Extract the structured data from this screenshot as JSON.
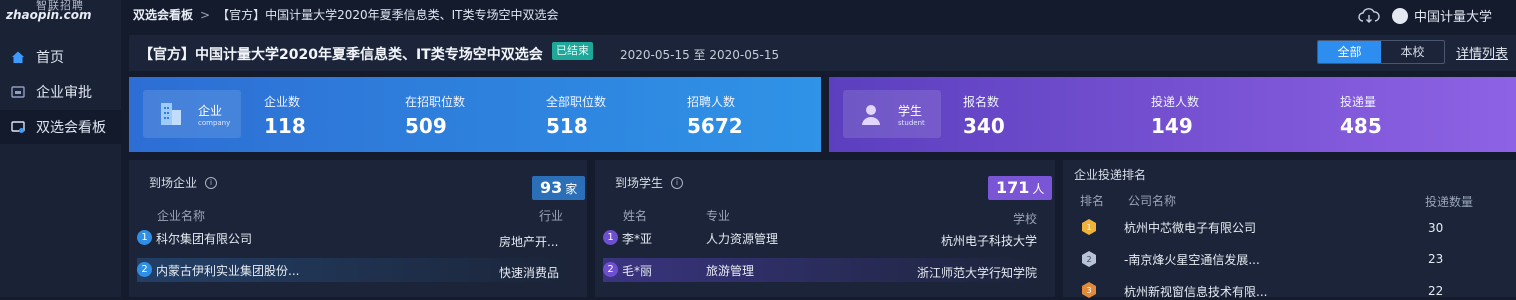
{
  "logo": {
    "top": "智联招聘",
    "bottom": "zhaopin.com"
  },
  "sidebar": {
    "items": [
      {
        "label": "首页",
        "icon": "home-icon"
      },
      {
        "label": "企业审批",
        "icon": "approval-icon"
      },
      {
        "label": "双选会看板",
        "icon": "dashboard-icon",
        "active": true
      }
    ]
  },
  "breadcrumb": {
    "root": "双选会看板",
    "sep": ">",
    "current": "【官方】中国计量大学2020年夏季信息类、IT类专场空中双选会"
  },
  "user": {
    "name": "中国计量大学"
  },
  "event": {
    "title": "【官方】中国计量大学2020年夏季信息类、IT类专场空中双选会",
    "status": "已结束",
    "dates": "2020-05-15 至 2020-05-15"
  },
  "filter": {
    "all": "全部",
    "own": "本校",
    "detail_link": "详情列表"
  },
  "company_band": {
    "cn": "企业",
    "en": "company",
    "stats": [
      {
        "label": "企业数",
        "value": "118"
      },
      {
        "label": "在招职位数",
        "value": "509"
      },
      {
        "label": "全部职位数",
        "value": "518"
      },
      {
        "label": "招聘人数",
        "value": "5672"
      }
    ]
  },
  "student_band": {
    "cn": "学生",
    "en": "student",
    "stats": [
      {
        "label": "报名数",
        "value": "340"
      },
      {
        "label": "投递人数",
        "value": "149"
      },
      {
        "label": "投递量",
        "value": "485"
      }
    ]
  },
  "arrived_companies": {
    "title": "到场企业",
    "count": "93",
    "unit": "家",
    "headers": {
      "name": "企业名称",
      "industry": "行业"
    },
    "rows": [
      {
        "rank": "1",
        "name": "科尔集团有限公司",
        "industry": "房地产开..."
      },
      {
        "rank": "2",
        "name": "内蒙古伊利实业集团股份...",
        "industry": "快速消费品"
      }
    ]
  },
  "arrived_students": {
    "title": "到场学生",
    "count": "171",
    "unit": "人",
    "headers": {
      "name": "姓名",
      "major": "专业",
      "school": "学校"
    },
    "rows": [
      {
        "rank": "1",
        "name": "李*亚",
        "major": "人力资源管理",
        "school": "杭州电子科技大学"
      },
      {
        "rank": "2",
        "name": "毛*丽",
        "major": "旅游管理",
        "school": "浙江师范大学行知学院"
      }
    ]
  },
  "ranking": {
    "title": "企业投递排名",
    "headers": {
      "rank": "排名",
      "company": "公司名称",
      "count": "投递数量"
    },
    "rows": [
      {
        "company": "杭州中芯微电子有限公司",
        "count": "30",
        "medal": "gold"
      },
      {
        "company": "-南京烽火星空通信发展...",
        "count": "23",
        "medal": "silver"
      },
      {
        "company": "杭州新视窗信息技术有限...",
        "count": "22",
        "medal": "bronze"
      }
    ]
  },
  "colors": {
    "blue_band": "#2f8fe6",
    "purple_band": "#8a5fe2",
    "accent": "#2e8ef0",
    "ended": "#1fa89a"
  }
}
